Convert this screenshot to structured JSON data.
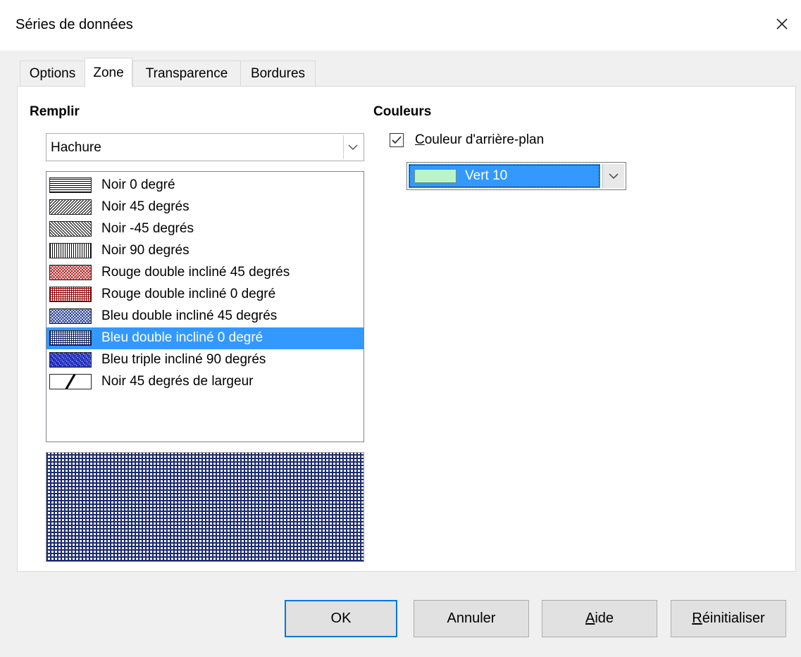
{
  "window": {
    "title": "Séries de données"
  },
  "tabs": [
    {
      "label": "Options"
    },
    {
      "label": "Zone"
    },
    {
      "label": "Transparence"
    },
    {
      "label": "Bordures"
    }
  ],
  "active_tab": "Zone",
  "fill": {
    "group_label": "Remplir",
    "type_value": "Hachure",
    "hatch_items": [
      {
        "label": "Noir 0 degré",
        "pattern": "horizontal",
        "color": "#000000"
      },
      {
        "label": "Noir 45 degrés",
        "pattern": "diag45",
        "color": "#000000"
      },
      {
        "label": "Noir -45 degrés",
        "pattern": "diag-45",
        "color": "#000000"
      },
      {
        "label": "Noir 90 degrés",
        "pattern": "vertical",
        "color": "#000000"
      },
      {
        "label": "Rouge double incliné 45 degrés",
        "pattern": "cross45",
        "color": "#b22222"
      },
      {
        "label": "Rouge double incliné 0 degré",
        "pattern": "cross0",
        "color": "#8b0000"
      },
      {
        "label": "Bleu double incliné 45 degrés",
        "pattern": "cross45",
        "color": "#1f3a93"
      },
      {
        "label": "Bleu double incliné 0 degré",
        "pattern": "cross0",
        "color": "#0b1b5a"
      },
      {
        "label": "Bleu triple incliné 90 degrés",
        "pattern": "triple",
        "color": "#1c2bbd"
      },
      {
        "label": "Noir 45 degrés de largeur",
        "pattern": "wide45",
        "color": "#000000"
      }
    ],
    "selected_index": 7,
    "selected_color": "#3399ff"
  },
  "colors": {
    "group_label": "Couleurs",
    "background_checkbox_label_mnemonic": "C",
    "background_checkbox_label_rest": "ouleur d'arrière-plan",
    "background_checked": true,
    "background_color_name": "Vert 10",
    "background_color_hex": "#b9f5c8"
  },
  "buttons": {
    "ok": "OK",
    "cancel": "Annuler",
    "help_mnemonic": "A",
    "help_rest": "ide",
    "reset_mnemonic": "R",
    "reset_rest": "éinitialiser"
  }
}
